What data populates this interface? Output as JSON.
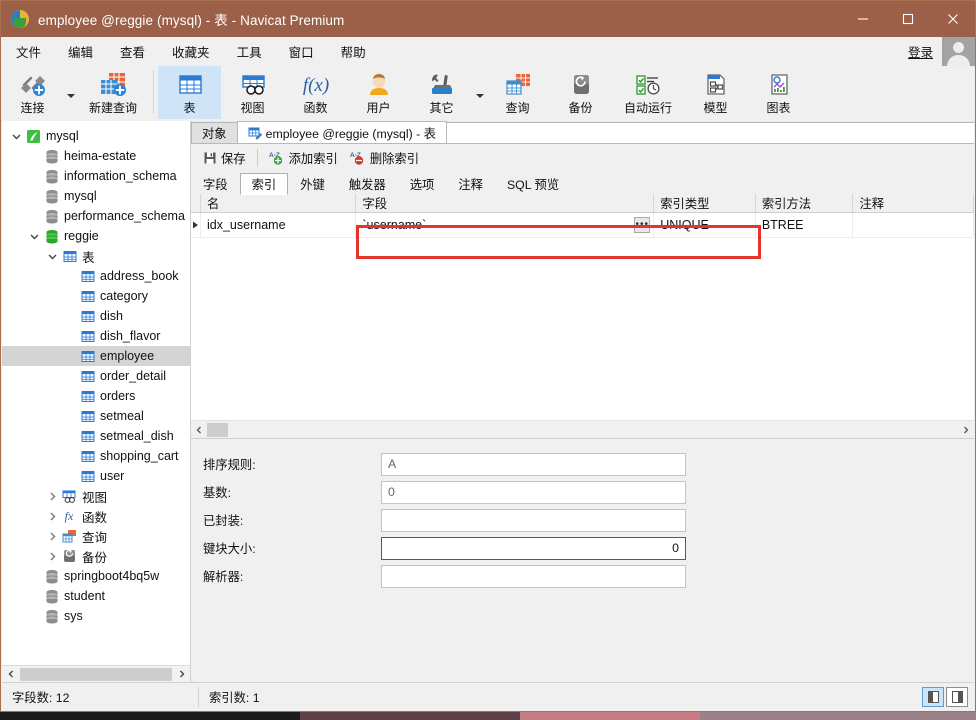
{
  "window": {
    "title": "employee @reggie (mysql) - 表 - Navicat Premium",
    "minimize": "—",
    "maximize": "□",
    "close": "✕"
  },
  "menubar": {
    "items": [
      "文件",
      "编辑",
      "查看",
      "收藏夹",
      "工具",
      "窗口",
      "帮助"
    ],
    "login_label": "登录"
  },
  "ribbon": {
    "groups": [
      {
        "buttons": [
          {
            "label": "连接",
            "icon": "connection-icon",
            "caret": true
          },
          {
            "label": "新建查询",
            "icon": "new-query-icon",
            "caret": false
          }
        ]
      },
      {
        "buttons": [
          {
            "label": "表",
            "icon": "table-icon",
            "active": true,
            "caret": false
          },
          {
            "label": "视图",
            "icon": "view-icon",
            "caret": false
          },
          {
            "label": "函数",
            "icon": "function-icon",
            "caret": false
          },
          {
            "label": "用户",
            "icon": "user-icon",
            "caret": false
          },
          {
            "label": "其它",
            "icon": "other-icon",
            "caret": true
          },
          {
            "label": "查询",
            "icon": "query-icon",
            "caret": false
          },
          {
            "label": "备份",
            "icon": "backup-icon",
            "caret": false
          },
          {
            "label": "自动运行",
            "icon": "automation-icon",
            "caret": false
          },
          {
            "label": "模型",
            "icon": "model-icon",
            "caret": false
          },
          {
            "label": "图表",
            "icon": "chart-icon",
            "caret": false
          }
        ]
      }
    ]
  },
  "sidebar": {
    "tree": [
      {
        "label": "mysql",
        "depth": 0,
        "icon": "navicat-connection-icon",
        "twisty": "expanded"
      },
      {
        "label": "heima-estate",
        "depth": 1,
        "icon": "database-icon",
        "twisty": "none"
      },
      {
        "label": "information_schema",
        "depth": 1,
        "icon": "database-icon",
        "twisty": "none"
      },
      {
        "label": "mysql",
        "depth": 1,
        "icon": "database-icon",
        "twisty": "none"
      },
      {
        "label": "performance_schema",
        "depth": 1,
        "icon": "database-icon",
        "twisty": "none"
      },
      {
        "label": "reggie",
        "depth": 1,
        "icon": "database-open-icon",
        "twisty": "expanded"
      },
      {
        "label": "表",
        "depth": 2,
        "icon": "tables-folder-icon",
        "twisty": "expanded"
      },
      {
        "label": "address_book",
        "depth": 3,
        "icon": "table-item-icon",
        "twisty": "none"
      },
      {
        "label": "category",
        "depth": 3,
        "icon": "table-item-icon",
        "twisty": "none"
      },
      {
        "label": "dish",
        "depth": 3,
        "icon": "table-item-icon",
        "twisty": "none"
      },
      {
        "label": "dish_flavor",
        "depth": 3,
        "icon": "table-item-icon",
        "twisty": "none"
      },
      {
        "label": "employee",
        "depth": 3,
        "icon": "table-item-icon",
        "twisty": "none",
        "selected": true
      },
      {
        "label": "order_detail",
        "depth": 3,
        "icon": "table-item-icon",
        "twisty": "none"
      },
      {
        "label": "orders",
        "depth": 3,
        "icon": "table-item-icon",
        "twisty": "none"
      },
      {
        "label": "setmeal",
        "depth": 3,
        "icon": "table-item-icon",
        "twisty": "none"
      },
      {
        "label": "setmeal_dish",
        "depth": 3,
        "icon": "table-item-icon",
        "twisty": "none"
      },
      {
        "label": "shopping_cart",
        "depth": 3,
        "icon": "table-item-icon",
        "twisty": "none"
      },
      {
        "label": "user",
        "depth": 3,
        "icon": "table-item-icon",
        "twisty": "none"
      },
      {
        "label": "视图",
        "depth": 2,
        "icon": "views-folder-icon",
        "twisty": "collapsed"
      },
      {
        "label": "函数",
        "depth": 2,
        "icon": "functions-folder-icon",
        "twisty": "collapsed"
      },
      {
        "label": "查询",
        "depth": 2,
        "icon": "queries-folder-icon",
        "twisty": "collapsed"
      },
      {
        "label": "备份",
        "depth": 2,
        "icon": "backups-folder-icon",
        "twisty": "collapsed"
      },
      {
        "label": "springboot4bq5w",
        "depth": 1,
        "icon": "database-icon",
        "twisty": "none"
      },
      {
        "label": "student",
        "depth": 1,
        "icon": "database-icon",
        "twisty": "none"
      },
      {
        "label": "sys",
        "depth": 1,
        "icon": "database-icon",
        "twisty": "none"
      }
    ]
  },
  "tabs": {
    "object_tab": "对象",
    "active_tab": "employee @reggie (mysql) - 表"
  },
  "object_toolbar": {
    "save": "保存",
    "add_index": "添加索引",
    "delete_index": "删除索引"
  },
  "subtabs": {
    "items": [
      "字段",
      "索引",
      "外键",
      "触发器",
      "选项",
      "注释",
      "SQL 预览"
    ],
    "active": "索引"
  },
  "grid": {
    "columns": [
      "名",
      "字段",
      "索引类型",
      "索引方法",
      "注释"
    ],
    "rows": [
      {
        "名": "idx_username",
        "字段": "`username`",
        "索引类型": "UNIQUE",
        "索引方法": "BTREE",
        "注释": ""
      }
    ],
    "ellipsis_label": "•••"
  },
  "properties": {
    "fields": [
      {
        "label": "排序规则:",
        "value": "A",
        "focused": false,
        "align": "left"
      },
      {
        "label": "基数:",
        "value": "0",
        "focused": false,
        "align": "left"
      },
      {
        "label": "已封装:",
        "value": "",
        "focused": false,
        "align": "left"
      },
      {
        "label": "键块大小:",
        "value": "0",
        "focused": true,
        "align": "right"
      },
      {
        "label": "解析器:",
        "value": "",
        "focused": false,
        "align": "left"
      }
    ]
  },
  "statusbar": {
    "field_count": "字段数: 12",
    "index_count": "索引数: 1"
  },
  "colors": {
    "titlebar": "#9c5f47",
    "accent_blue": "#2b7bd4",
    "annotation_red": "#e5342a",
    "selection_gray": "#d4d4d4",
    "ribbon_active": "#cfe4f7"
  }
}
